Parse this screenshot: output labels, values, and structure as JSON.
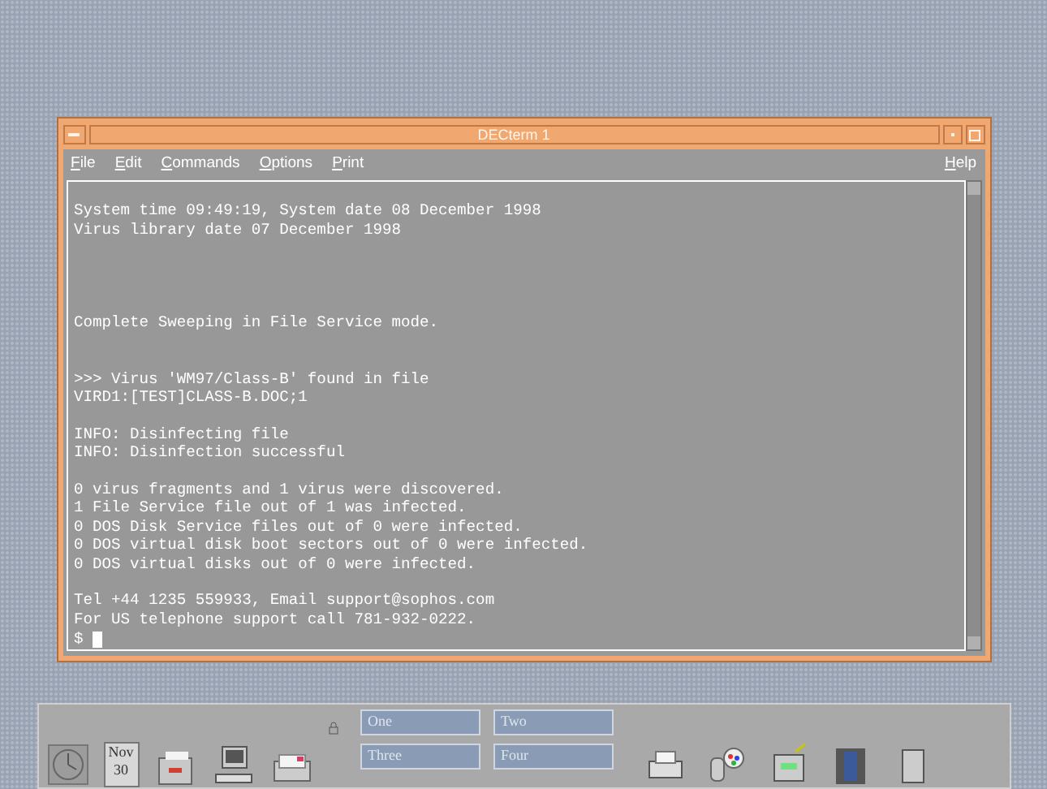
{
  "window": {
    "title": "DECterm 1"
  },
  "menus": [
    {
      "label": "File"
    },
    {
      "label": "Edit"
    },
    {
      "label": "Commands"
    },
    {
      "label": "Options"
    },
    {
      "label": "Print"
    }
  ],
  "help_menu": {
    "label": "Help"
  },
  "terminal": {
    "blocks": [
      {
        "lines": [
          "System time 09:49:19, System date 08 December 1998",
          "Virus library date 07 December 1998"
        ]
      },
      {
        "lines": [
          "Complete Sweeping in File Service mode."
        ]
      },
      {
        "lines": [
          ">>> Virus 'WM97/Class-B' found in file",
          "VIRD1:[TEST]CLASS-B.DOC;1"
        ]
      },
      {
        "lines": [
          "INFO: Disinfecting file",
          "INFO: Disinfection successful"
        ]
      },
      {
        "lines": [
          "0 virus fragments and 1 virus were discovered.",
          "1 File Service file out of 1 was infected.",
          "0 DOS Disk Service files out of 0 were infected.",
          "0 DOS virtual disk boot sectors out of 0 were infected.",
          "0 DOS virtual disks out of 0 were infected."
        ]
      },
      {
        "lines": [
          "Tel +44 1235 559933, Email support@sophos.com",
          "For US telephone support call 781-932-0222."
        ]
      }
    ],
    "prompt": "$"
  },
  "front_panel": {
    "calendar": {
      "month": "Nov",
      "day": "30"
    },
    "workspaces": [
      {
        "label": "One"
      },
      {
        "label": "Two"
      },
      {
        "label": "Three"
      },
      {
        "label": "Four"
      }
    ]
  }
}
